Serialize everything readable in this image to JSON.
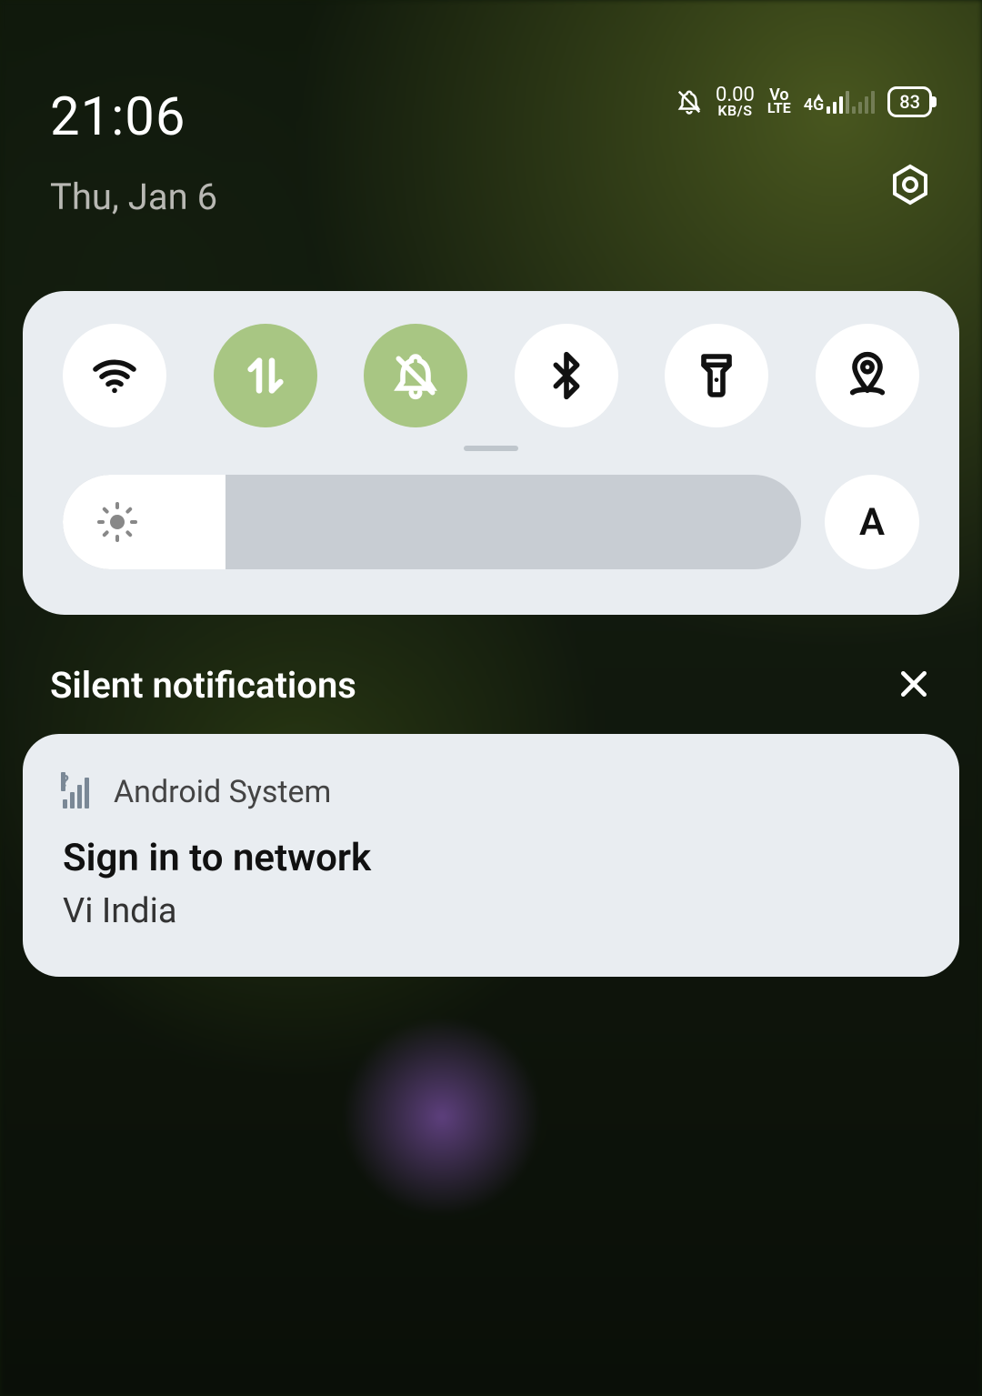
{
  "status": {
    "time": "21:06",
    "date": "Thu, Jan 6",
    "net_speed_value": "0.00",
    "net_speed_unit": "KB/S",
    "volte_top": "Vo",
    "volte_bot": "LTE",
    "net_type": "4G",
    "battery_pct": "83"
  },
  "quick_settings": {
    "toggles": [
      {
        "name": "wifi",
        "active": false
      },
      {
        "name": "mobile-data",
        "active": true
      },
      {
        "name": "do-not-disturb",
        "active": true
      },
      {
        "name": "bluetooth",
        "active": false
      },
      {
        "name": "flashlight",
        "active": false
      },
      {
        "name": "location",
        "active": false
      }
    ],
    "brightness_pct": 22,
    "auto_brightness_label": "A"
  },
  "silent_section": {
    "label": "Silent notifications"
  },
  "notification": {
    "app": "Android System",
    "title": "Sign in to network",
    "body": "Vi India"
  }
}
